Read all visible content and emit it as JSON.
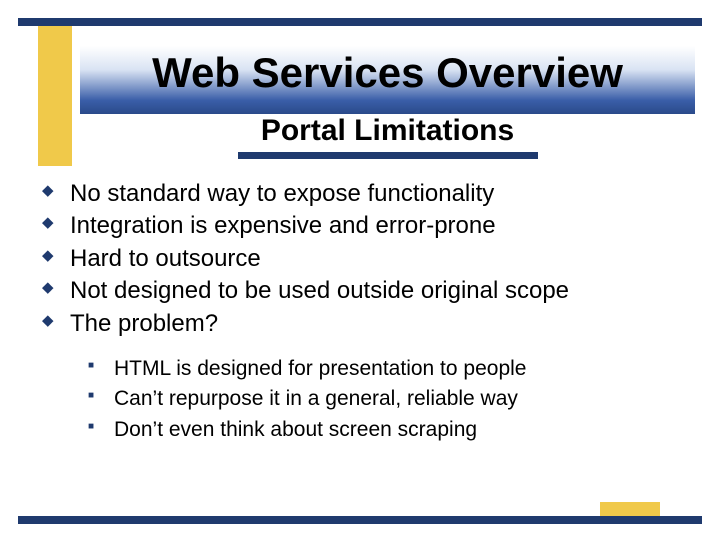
{
  "title": "Web Services Overview",
  "subtitle": "Portal Limitations",
  "bullets": [
    "No standard way to expose functionality",
    "Integration is expensive and error-prone",
    "Hard to outsource",
    "Not designed to be used outside original scope",
    "The problem?"
  ],
  "sub_bullets": [
    "HTML is designed for presentation to people",
    "Can’t repurpose it in a general, reliable way",
    "Don’t even think about screen scraping"
  ]
}
